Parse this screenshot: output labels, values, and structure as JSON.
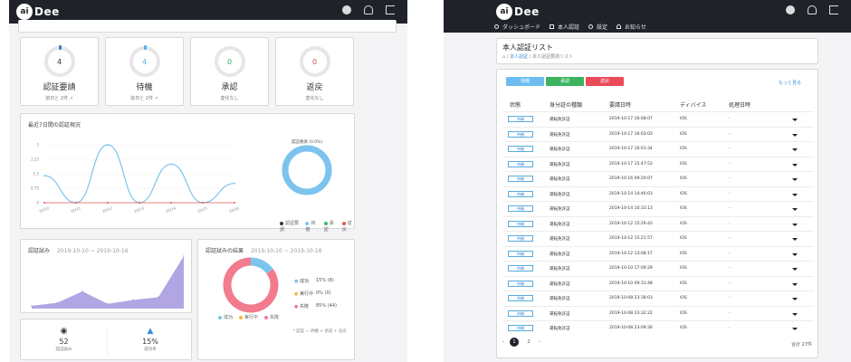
{
  "brand": {
    "ai": "ai",
    "name": "Dee"
  },
  "left": {
    "stats": [
      {
        "value": "4",
        "title": "認証要請",
        "sub": "前日と 2件",
        "color": "#3a82c5"
      },
      {
        "value": "4",
        "title": "待機",
        "sub": "前日と 2件",
        "color": "#54aee8"
      },
      {
        "value": "0",
        "title": "承認",
        "sub": "変化なし",
        "color": "#2fb35a"
      },
      {
        "value": "0",
        "title": "返戻",
        "sub": "変化なし",
        "color": "#e04c4c"
      }
    ],
    "trend": {
      "title": "最近7日間の認証現況",
      "y_ticks": [
        "3",
        "2.25",
        "1.5",
        "0.75",
        "0"
      ],
      "x_ticks": [
        "10/10",
        "10/11",
        "10/12",
        "10/13",
        "10/14",
        "10/15",
        "10/16"
      ],
      "donut_label": "認証要請 (0.0%)",
      "legend": [
        {
          "label": "認証要請",
          "color": "#2f3a4a"
        },
        {
          "label": "待機",
          "color": "#7cc4ee"
        },
        {
          "label": "承認",
          "color": "#3db565"
        },
        {
          "label": "返戻",
          "color": "#e45858"
        }
      ]
    },
    "attempts": {
      "title": "認証試み",
      "range": "2019-10-10 ~ 2019-10-16"
    },
    "results": {
      "title": "認証試みの結果",
      "range": "2019-10-10 ~ 2019-10-16",
      "rows": [
        {
          "k": "成功",
          "v": "15% (8)",
          "color": "#7cc4ee"
        },
        {
          "k": "実行中",
          "v": "0% (0)",
          "color": "#f4b942"
        },
        {
          "k": "失敗",
          "v": "85% (44)",
          "color": "#f27b8d"
        }
      ],
      "legend": [
        {
          "label": "成功",
          "color": "#7cc4ee"
        },
        {
          "label": "実行中",
          "color": "#f4b942"
        },
        {
          "label": "失敗",
          "color": "#f27b8d"
        }
      ],
      "note": "* 認証 = 待機 + 承認 + 返戻"
    },
    "summary": [
      {
        "icon": "eye-icon",
        "value": "52",
        "label": "認証試み"
      },
      {
        "icon": "thumbs-up-icon",
        "value": "15%",
        "label": "成功率"
      }
    ]
  },
  "right": {
    "nav": [
      {
        "label": "ダッシュボード",
        "icon": "dashboard-icon"
      },
      {
        "label": "本人認証",
        "icon": "id-card-icon"
      },
      {
        "label": "設定",
        "icon": "gear-icon"
      },
      {
        "label": "お知らせ",
        "icon": "bell-icon"
      }
    ],
    "page_title": "本人認証リスト",
    "breadcrumb": {
      "home": "⌂",
      "link": "本人認証",
      "current": "本人認証要請リスト"
    },
    "filters": [
      {
        "label": "待機",
        "color": "#6dbdf0"
      },
      {
        "label": "承認",
        "color": "#3cb35f"
      },
      {
        "label": "返戻",
        "color": "#ea4a5a"
      }
    ],
    "more": "もっと見る",
    "columns": [
      "状態",
      "身分証の種類",
      "要請日時",
      "ディバイス",
      "処理日時"
    ],
    "rows": [
      {
        "status": "待機",
        "type": "運転免許証",
        "date": "2019-10-17 16:08:07",
        "device": "IOS",
        "processed": "-"
      },
      {
        "status": "待機",
        "type": "運転免許証",
        "date": "2019-10-17 16:03:03",
        "device": "IOS",
        "processed": "-"
      },
      {
        "status": "待機",
        "type": "運転免許証",
        "date": "2019-10-17 16:01:34",
        "device": "IOS",
        "processed": "-"
      },
      {
        "status": "待機",
        "type": "運転免許証",
        "date": "2019-10-17 15:47:53",
        "device": "IOS",
        "processed": "-"
      },
      {
        "status": "待機",
        "type": "運転免許証",
        "date": "2019-10-16 09:20:07",
        "device": "IOS",
        "processed": "-"
      },
      {
        "status": "待機",
        "type": "運転免許証",
        "date": "2019-10-14 14:46:03",
        "device": "IOS",
        "processed": "-"
      },
      {
        "status": "待機",
        "type": "運転免許証",
        "date": "2019-10-14 10:33:13",
        "device": "IOS",
        "processed": "-"
      },
      {
        "status": "待機",
        "type": "運転免許証",
        "date": "2019-10-12 15:26:43",
        "device": "IOS",
        "processed": "-"
      },
      {
        "status": "待機",
        "type": "運転免許証",
        "date": "2019-10-12 15:21:57",
        "device": "IOS",
        "processed": "-"
      },
      {
        "status": "待機",
        "type": "運転免許証",
        "date": "2019-10-12 13:08:17",
        "device": "IOS",
        "processed": "-"
      },
      {
        "status": "待機",
        "type": "運転免許証",
        "date": "2019-10-10 17:09:29",
        "device": "IOS",
        "processed": "-"
      },
      {
        "status": "待機",
        "type": "運転免許証",
        "date": "2019-10-10 09:31:48",
        "device": "IOS",
        "processed": "-"
      },
      {
        "status": "待機",
        "type": "運転免許証",
        "date": "2019-10-08 23:38:03",
        "device": "IOS",
        "processed": "-"
      },
      {
        "status": "待機",
        "type": "運転免許証",
        "date": "2019-10-08 23:32:22",
        "device": "IOS",
        "processed": "-"
      },
      {
        "status": "待機",
        "type": "運転免許証",
        "date": "2019-10-08 23:09:30",
        "device": "IOS",
        "processed": "-"
      }
    ],
    "pagination": {
      "prev": "‹",
      "pages": [
        "1",
        "2"
      ],
      "next": "›",
      "total": "合計 27件"
    }
  },
  "chart_data": [
    {
      "type": "line",
      "title": "最近7日間の認証現況",
      "categories": [
        "10/10",
        "10/11",
        "10/12",
        "10/13",
        "10/14",
        "10/15",
        "10/16"
      ],
      "series": [
        {
          "name": "認証要請",
          "values": [
            1.4,
            0,
            3,
            0,
            2,
            0,
            1
          ]
        },
        {
          "name": "返戻",
          "values": [
            0,
            0,
            0,
            0,
            0,
            0,
            0
          ]
        }
      ],
      "ylim": [
        0,
        3
      ]
    },
    {
      "type": "area",
      "title": "認証試み",
      "categories": [
        "10/10",
        "10/11",
        "10/12",
        "10/13",
        "10/14",
        "10/15",
        "10/16"
      ],
      "values": [
        3,
        6,
        18,
        5,
        9,
        12,
        55
      ]
    },
    {
      "type": "pie",
      "title": "認証試みの結果",
      "labels": [
        "成功",
        "実行中",
        "失敗"
      ],
      "values": [
        15,
        0,
        85
      ]
    }
  ]
}
